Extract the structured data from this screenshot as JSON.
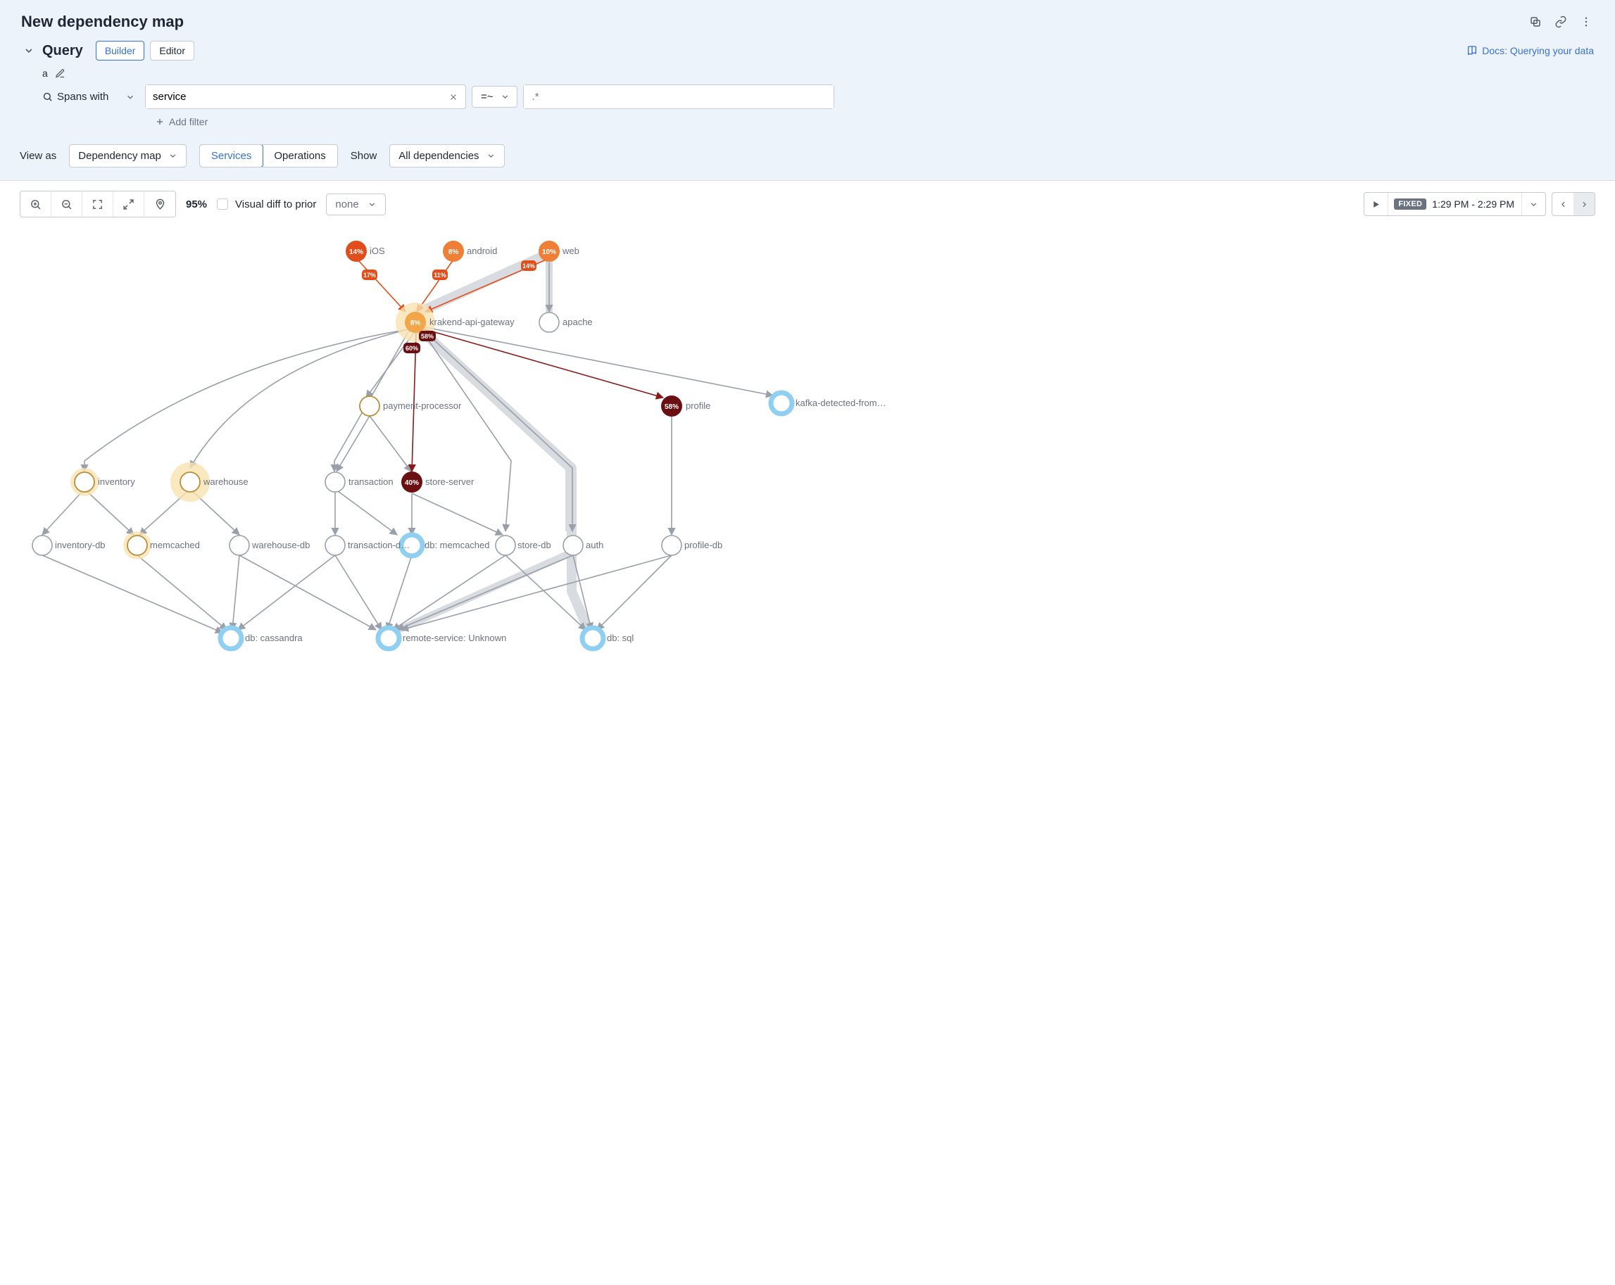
{
  "title": "New dependency map",
  "query": {
    "heading": "Query",
    "tabs": {
      "builder": "Builder",
      "editor": "Editor"
    },
    "docs_link": "Docs: Querying your data",
    "tag": "a",
    "spans_label": "Spans with",
    "field_value": "service",
    "operator": "=~",
    "value_placeholder": ".*",
    "add_filter": "Add filter"
  },
  "view": {
    "view_as": "View as",
    "view_value": "Dependency map",
    "seg_services": "Services",
    "seg_operations": "Operations",
    "show": "Show",
    "show_value": "All dependencies"
  },
  "toolbar": {
    "zoom_pct": "95%",
    "diff_label": "Visual diff to prior",
    "diff_value": "none",
    "fixed": "FIXED",
    "time_range": "1:29 PM - 2:29 PM"
  },
  "nodes": {
    "ios": {
      "label": "iOS",
      "pct": "14%"
    },
    "android": {
      "label": "android",
      "pct": "8%"
    },
    "web": {
      "label": "web",
      "pct": "10%"
    },
    "gateway": {
      "label": "krakend-api-gateway",
      "pct": "8%"
    },
    "apache": {
      "label": "apache"
    },
    "payment": {
      "label": "payment-processor"
    },
    "profile": {
      "label": "profile",
      "pct": "58%"
    },
    "kafka": {
      "label": "kafka-detected-from…"
    },
    "inventory": {
      "label": "inventory"
    },
    "warehouse": {
      "label": "warehouse"
    },
    "transaction": {
      "label": "transaction"
    },
    "store": {
      "label": "store-server",
      "pct": "40%"
    },
    "inventory_db": {
      "label": "inventory-db"
    },
    "memcached": {
      "label": "memcached"
    },
    "warehouse_db": {
      "label": "warehouse-db"
    },
    "transaction_db": {
      "label": "transaction-d…"
    },
    "db_memcached": {
      "label": "db: memcached"
    },
    "store_db": {
      "label": "store-db"
    },
    "auth": {
      "label": "auth"
    },
    "profile_db": {
      "label": "profile-db"
    },
    "db_cassandra": {
      "label": "db: cassandra"
    },
    "remote_unknown": {
      "label": "remote-service: Unknown"
    },
    "db_sql": {
      "label": "db: sql"
    }
  },
  "edge_labels": {
    "e17": "17%",
    "e11": "11%",
    "e14": "14%",
    "e60": "60%",
    "e58": "58%"
  }
}
